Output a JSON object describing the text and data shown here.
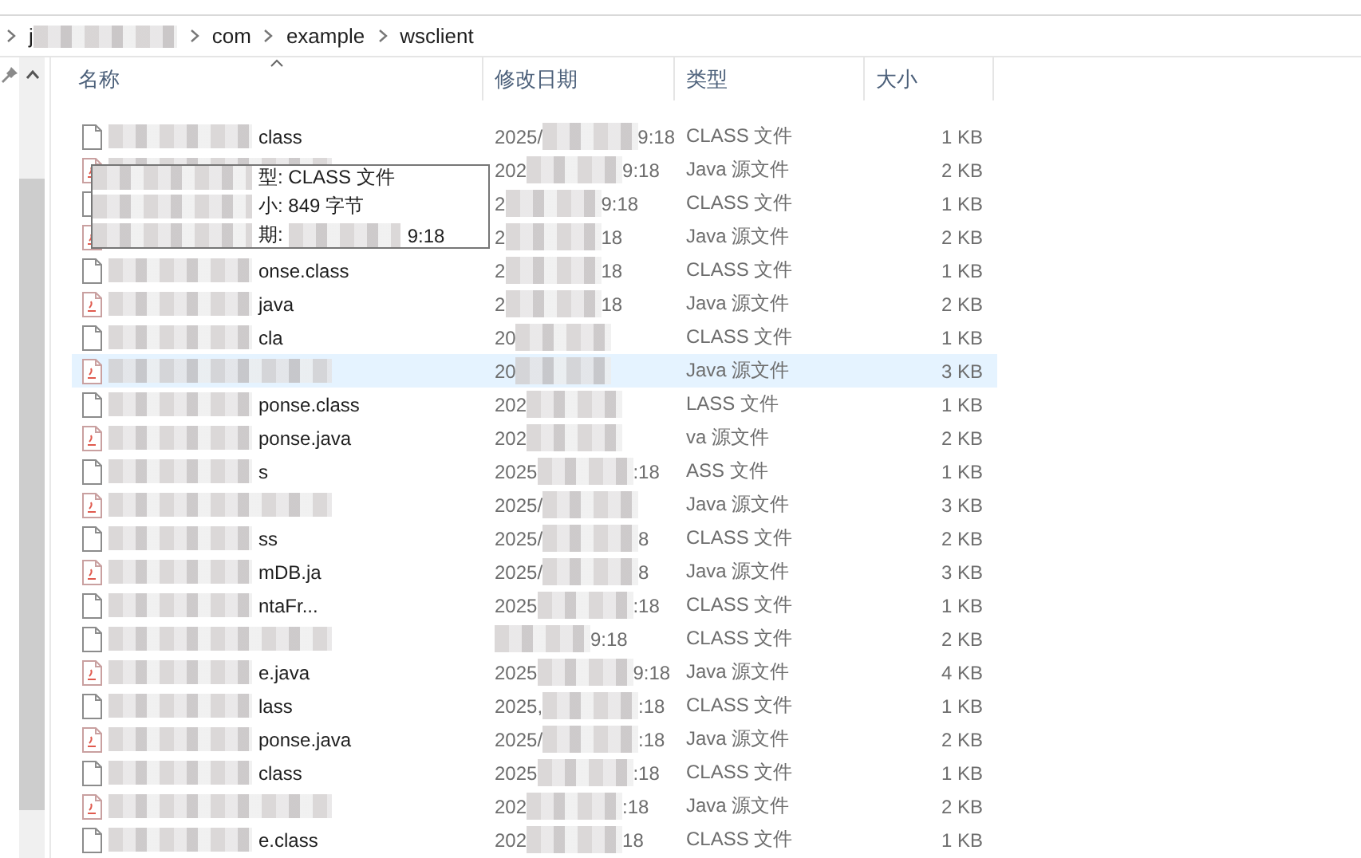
{
  "breadcrumb": {
    "items": [
      "j",
      "com",
      "example",
      "wsclient"
    ]
  },
  "columns": [
    {
      "label": "名称",
      "sorted": true
    },
    {
      "label": "修改日期",
      "sorted": false
    },
    {
      "label": "类型",
      "sorted": false
    },
    {
      "label": "大小",
      "sorted": false
    }
  ],
  "rows": [
    {
      "kind": "class",
      "name": "class",
      "date_start": "2025/",
      "date_end": "9:18",
      "type": "CLASS 文件",
      "size": "1 KB",
      "selected": false
    },
    {
      "kind": "java",
      "date_start": "202",
      "date_end": "9:18",
      "type": "Java 源文件",
      "size": "2 KB",
      "selected": false
    },
    {
      "kind": "class",
      "date_start": "2",
      "date_end": "9:18",
      "type": "CLASS 文件",
      "size": "1 KB",
      "selected": false
    },
    {
      "kind": "java",
      "date_start": "2",
      "date_end": "18",
      "type": "Java 源文件",
      "size": "2 KB",
      "selected": false
    },
    {
      "kind": "class",
      "name": "onse.class",
      "date_start": "2",
      "date_end": "18",
      "type": "CLASS 文件",
      "size": "1 KB",
      "selected": false
    },
    {
      "kind": "java",
      "name": "java",
      "date_start": "2",
      "date_end": "18",
      "type": "Java 源文件",
      "size": "2 KB",
      "selected": false
    },
    {
      "kind": "class",
      "name": "cla",
      "date_start": "20",
      "type": "CLASS 文件",
      "size": "1 KB",
      "selected": false
    },
    {
      "kind": "java",
      "date_start": "20",
      "type": "Java 源文件",
      "size": "3 KB",
      "selected": true
    },
    {
      "kind": "class",
      "name": "ponse.class",
      "date_start": "202",
      "type": "LASS 文件",
      "size": "1 KB",
      "selected": false
    },
    {
      "kind": "java",
      "name": "ponse.java",
      "date_start": "202",
      "type": "va 源文件",
      "size": "2 KB",
      "selected": false
    },
    {
      "kind": "class",
      "name": "s",
      "date_start": "2025",
      "date_end": ":18",
      "type": "ASS 文件",
      "size": "1 KB",
      "selected": false
    },
    {
      "kind": "java",
      "date_start": "2025/",
      "type": "Java 源文件",
      "size": "3 KB",
      "selected": false
    },
    {
      "kind": "class",
      "name": "ss",
      "date_start": "2025/",
      "date_end": "8",
      "type": "CLASS 文件",
      "size": "2 KB",
      "selected": false
    },
    {
      "kind": "java",
      "name": "mDB.ja",
      "date_start": "2025/",
      "date_end": "8",
      "type": "Java 源文件",
      "size": "3 KB",
      "selected": false
    },
    {
      "kind": "class",
      "name": "ntaFr...",
      "date_start": "2025",
      "date_end": ":18",
      "type": "CLASS 文件",
      "size": "1 KB",
      "selected": false
    },
    {
      "kind": "class",
      "date_end": "9:18",
      "type": "CLASS 文件",
      "size": "2 KB",
      "selected": false
    },
    {
      "kind": "java",
      "name": "e.java",
      "date_start": "2025",
      "date_end": "9:18",
      "type": "Java 源文件",
      "size": "4 KB",
      "selected": false
    },
    {
      "kind": "class",
      "name": "lass",
      "date_start": "2025,",
      "date_end": ":18",
      "type": "CLASS 文件",
      "size": "1 KB",
      "selected": false
    },
    {
      "kind": "java",
      "name": "ponse.java",
      "date_start": "2025/",
      "date_end": ":18",
      "type": "Java 源文件",
      "size": "2 KB",
      "selected": false
    },
    {
      "kind": "class",
      "name": "class",
      "date_start": "2025",
      "date_end": ":18",
      "type": "CLASS 文件",
      "size": "1 KB",
      "selected": false
    },
    {
      "kind": "java",
      "date_start": "202",
      "date_end": ":18",
      "type": "Java 源文件",
      "size": "2 KB",
      "selected": false
    },
    {
      "kind": "class",
      "name": "e.class",
      "date_start": "202",
      "date_end": "18",
      "type": "CLASS 文件",
      "size": "1 KB",
      "selected": false
    }
  ],
  "tooltip": {
    "lines": [
      {
        "text": "型: CLASS 文件"
      },
      {
        "text": "小: 849 字节"
      },
      {
        "text": "期:",
        "tail": "9:18"
      }
    ]
  }
}
